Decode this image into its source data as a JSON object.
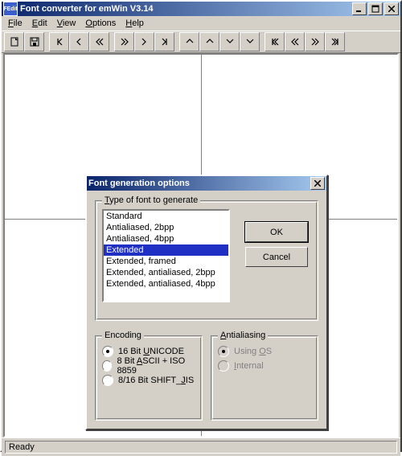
{
  "window": {
    "title": "Font converter for emWin V3.14",
    "app_icon_text": "FEdit",
    "menu": [
      "File",
      "Edit",
      "View",
      "Options",
      "Help"
    ],
    "statusbar": "Ready"
  },
  "toolbar_icons": [
    "new-doc-icon",
    "save-icon",
    "sep",
    "move-first-icon",
    "move-left-icon",
    "move-far-left-icon",
    "sep",
    "move-far-right-icon",
    "move-right-icon",
    "move-last-icon",
    "sep",
    "arrow-up-icon",
    "arrow-up-alt-icon",
    "arrow-down-icon",
    "arrow-down-alt-icon",
    "sep",
    "prev-start-icon",
    "prev-icon",
    "next-icon",
    "next-end-icon"
  ],
  "dialog": {
    "title": "Font generation options",
    "group_type_label": "Type of font to generate",
    "list": [
      "Standard",
      "Antialiased, 2bpp",
      "Antialiased, 4bpp",
      "Extended",
      "Extended, framed",
      "Extended, antialiased, 2bpp",
      "Extended, antialiased, 4bpp"
    ],
    "selected_index": 3,
    "ok_label": "OK",
    "cancel_label": "Cancel",
    "encoding": {
      "label": "Encoding",
      "options": [
        {
          "label": "16 Bit UNICODE",
          "ul": "U",
          "enabled": true,
          "selected": true
        },
        {
          "label": "8 Bit ASCII + ISO 8859",
          "ul": "A",
          "enabled": true,
          "selected": false
        },
        {
          "label": "8/16 Bit SHIFT_JIS",
          "ul": "J",
          "enabled": true,
          "selected": false
        }
      ]
    },
    "antialiasing": {
      "label": "Antialiasing",
      "options": [
        {
          "label": "Using OS",
          "ul": "O",
          "enabled": false,
          "selected": true
        },
        {
          "label": "Internal",
          "ul": "I",
          "enabled": false,
          "selected": false
        }
      ]
    }
  }
}
